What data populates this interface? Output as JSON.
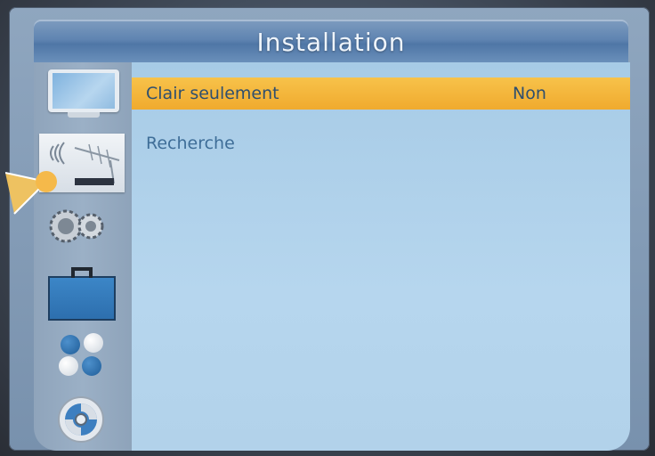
{
  "header": {
    "title": "Installation"
  },
  "sidebar": {
    "items": [
      {
        "icon": "tv-icon"
      },
      {
        "icon": "antenna-icon",
        "active": true
      },
      {
        "icon": "gears-icon"
      },
      {
        "icon": "toolbox-icon"
      },
      {
        "icon": "balls-icon"
      },
      {
        "icon": "disc-icon"
      }
    ]
  },
  "menu": {
    "items": [
      {
        "label": "Clair seulement",
        "value": "Non",
        "selected": true
      },
      {
        "label": "Recherche",
        "value": ""
      }
    ]
  },
  "colors": {
    "selection": "#f0aa2e",
    "content_bg": "#b1d2ec",
    "title_bar": "#5f84b1",
    "text": "#3f6e98"
  }
}
